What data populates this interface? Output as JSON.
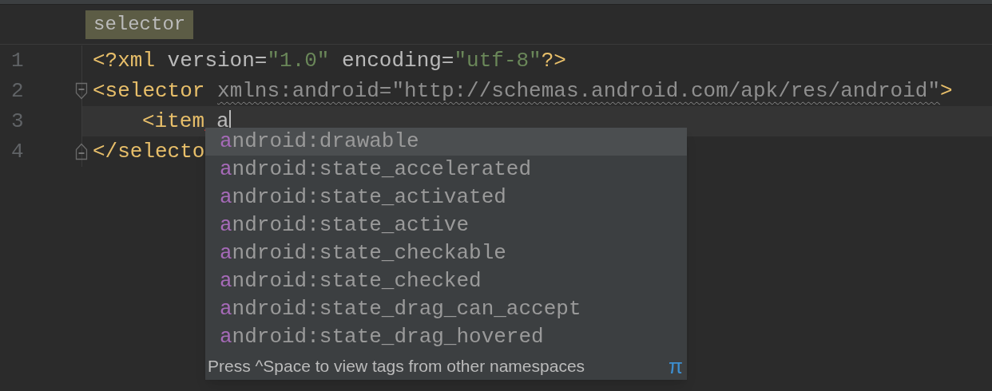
{
  "breadcrumb": {
    "label": "selector"
  },
  "lines": [
    {
      "number": "1",
      "caret": false,
      "fold_open": false,
      "fold_close": false,
      "indented": false,
      "tokens": [
        {
          "kind": "tag",
          "text": "<?xml"
        },
        {
          "kind": "plain",
          "text": "version=",
          "space_before": true
        },
        {
          "kind": "value",
          "text": "\"1.0\""
        },
        {
          "kind": "plain",
          "text": "encoding=",
          "space_before": true
        },
        {
          "kind": "value",
          "text": "\"utf-8\""
        },
        {
          "kind": "tag",
          "text": "?>"
        }
      ]
    },
    {
      "number": "2",
      "caret": false,
      "fold_open": true,
      "fold_close": false,
      "indented": false,
      "tokens": [
        {
          "kind": "tag",
          "text": "<selector"
        },
        {
          "kind": "warning",
          "text": "xmlns:android=\"http://schemas.android.com/apk/res/android\"",
          "space_before": true
        },
        {
          "kind": "tag",
          "text": ">"
        }
      ]
    },
    {
      "number": "3",
      "caret": true,
      "fold_open": false,
      "fold_close": false,
      "indented": true,
      "tokens": [
        {
          "kind": "tag",
          "text": "<item",
          "error_after": true
        },
        {
          "kind": "plain",
          "text": "a"
        }
      ]
    },
    {
      "number": "4",
      "caret": false,
      "fold_open": false,
      "fold_close": true,
      "indented": false,
      "tokens": [
        {
          "kind": "tag",
          "text": "</selecto"
        }
      ]
    }
  ],
  "completion": {
    "items": [
      {
        "match": "a",
        "text": "ndroid:drawable",
        "selected": true
      },
      {
        "match": "a",
        "text": "ndroid:state_accelerated",
        "selected": false
      },
      {
        "match": "a",
        "text": "ndroid:state_activated",
        "selected": false
      },
      {
        "match": "a",
        "text": "ndroid:state_active",
        "selected": false
      },
      {
        "match": "a",
        "text": "ndroid:state_checkable",
        "selected": false
      },
      {
        "match": "a",
        "text": "ndroid:state_checked",
        "selected": false
      },
      {
        "match": "a",
        "text": "ndroid:state_drag_can_accept",
        "selected": false
      },
      {
        "match": "a",
        "text": "ndroid:state_drag_hovered",
        "selected": false
      }
    ],
    "hint": "Press ^Space to view tags from other namespaces",
    "hint_symbol": "π"
  }
}
